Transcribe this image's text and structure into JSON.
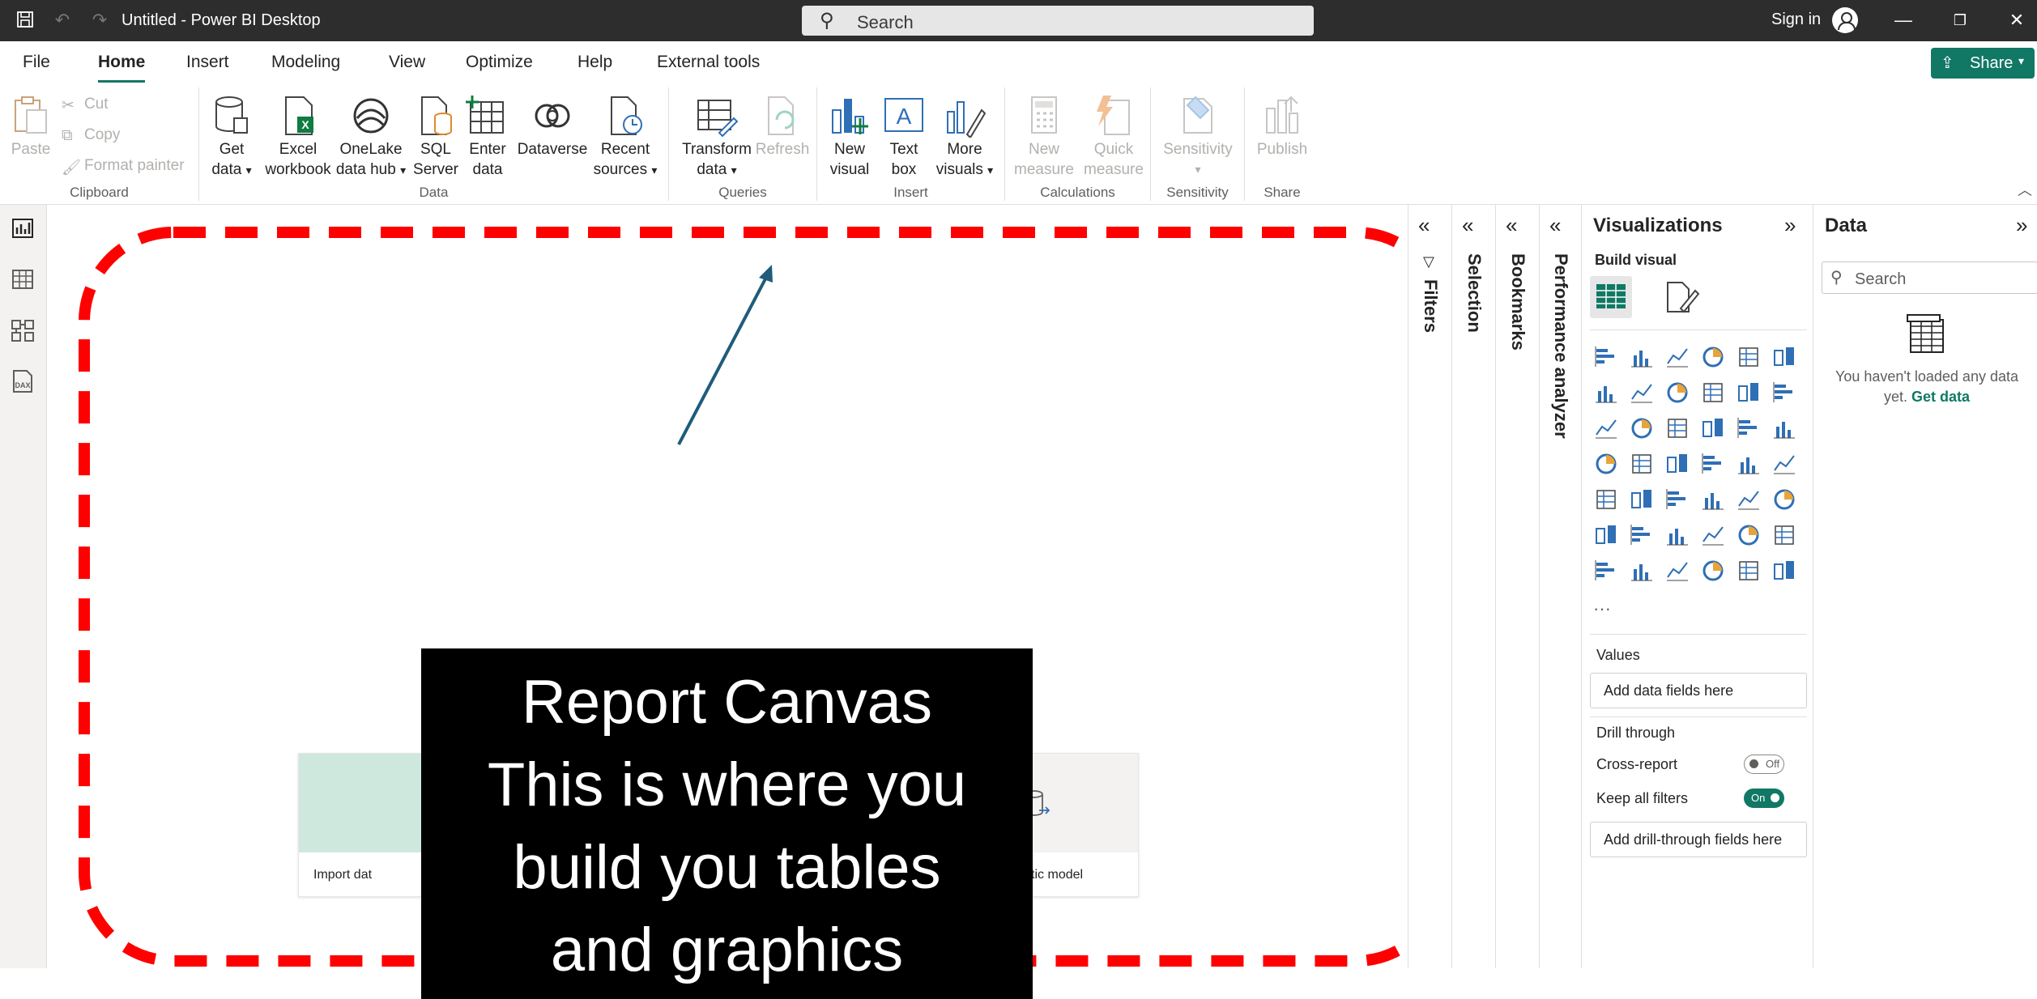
{
  "titlebar": {
    "title": "Untitled - Power BI Desktop",
    "search_placeholder": "Search",
    "signin": "Sign in"
  },
  "menu": {
    "tabs": [
      "File",
      "Home",
      "Insert",
      "Modeling",
      "View",
      "Optimize",
      "Help",
      "External tools"
    ],
    "active": "Home",
    "share": "Share"
  },
  "ribbon": {
    "clipboard": {
      "label": "Clipboard",
      "paste": "Paste",
      "cut": "Cut",
      "copy": "Copy",
      "format_painter": "Format painter"
    },
    "data": {
      "label": "Data",
      "get_data": [
        "Get",
        "data"
      ],
      "excel": [
        "Excel",
        "workbook"
      ],
      "onelake": [
        "OneLake",
        "data hub"
      ],
      "sql": [
        "SQL",
        "Server"
      ],
      "enter": [
        "Enter",
        "data"
      ],
      "dataverse": "Dataverse",
      "recent": [
        "Recent",
        "sources"
      ]
    },
    "queries": {
      "label": "Queries",
      "transform": [
        "Transform",
        "data"
      ],
      "refresh": "Refresh"
    },
    "insert": {
      "label": "Insert",
      "new_visual": [
        "New",
        "visual"
      ],
      "text_box": [
        "Text",
        "box"
      ],
      "more_visuals": [
        "More",
        "visuals"
      ]
    },
    "calculations": {
      "label": "Calculations",
      "new_measure": [
        "New",
        "measure"
      ],
      "quick_measure": [
        "Quick",
        "measure"
      ]
    },
    "sensitivity": {
      "label": "Sensitivity",
      "btn": "Sensitivity"
    },
    "share": {
      "label": "Share",
      "publish": "Publish"
    }
  },
  "canvas": {
    "card_left_label": "Import dat",
    "card_right_label": "sample semantic model",
    "callout_lines": [
      "Report Canvas",
      "This is where you",
      "build you tables",
      "and graphics"
    ],
    "dash_color": "#ff0000",
    "arrow_color": "#1f5c7a"
  },
  "panes": {
    "filters": "Filters",
    "selection": "Selection",
    "bookmarks": "Bookmarks",
    "performance": "Performance analyzer"
  },
  "visualizations": {
    "title": "Visualizations",
    "build_visual": "Build visual",
    "values_label": "Values",
    "values_placeholder": "Add data fields here",
    "drill_label": "Drill through",
    "cross_report": "Cross-report",
    "cross_report_state": "Off",
    "keep_filters": "Keep all filters",
    "keep_filters_state": "On",
    "drill_placeholder": "Add drill-through fields here",
    "more": "···"
  },
  "data_pane": {
    "title": "Data",
    "search_placeholder": "Search",
    "empty_text": "You haven't loaded any data yet.",
    "get_data_link": "Get data"
  },
  "colors": {
    "accent": "#117865",
    "titlebar": "#2d2d2d",
    "icon_blue": "#2f6fb5"
  }
}
